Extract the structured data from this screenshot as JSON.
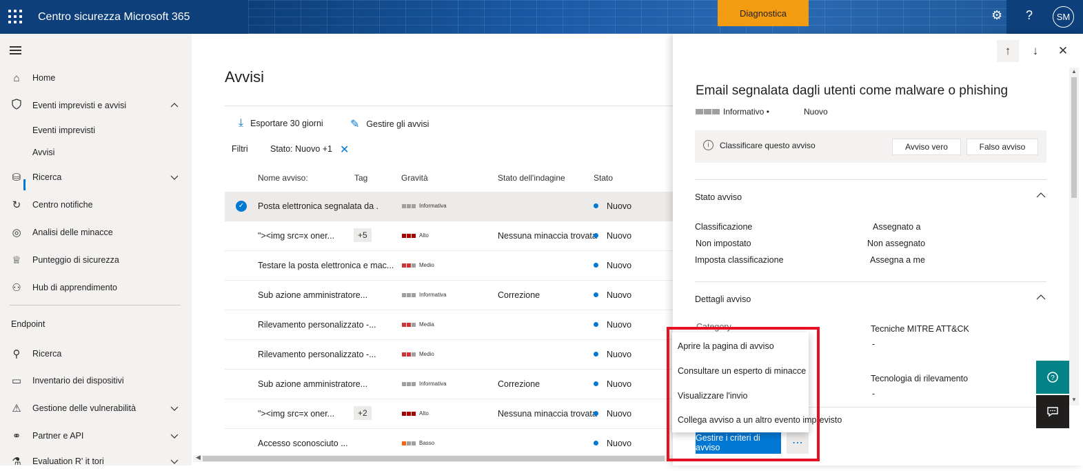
{
  "topbar": {
    "app_title": "Centro sicurezza Microsoft 365",
    "diagnostic_label": "Diagnostica",
    "avatar_initials": "SM",
    "settings_icon": "gear-icon",
    "help_icon": "question-icon"
  },
  "sidebar": {
    "items": [
      {
        "label": "Home",
        "icon": "home-icon"
      },
      {
        "label": "Eventi imprevisti e avvisi",
        "icon": "shield-icon"
      },
      {
        "label": "Eventi imprevisti"
      },
      {
        "label": "Avvisi"
      },
      {
        "label": "Ricerca",
        "icon": "hunting-icon"
      },
      {
        "label": "Centro notifiche",
        "icon": "action-center-icon"
      },
      {
        "label": "Analisi delle minacce",
        "icon": "threat-analytics-icon"
      },
      {
        "label": "Punteggio di sicurezza",
        "icon": "trophy-icon"
      },
      {
        "label": "Hub di apprendimento",
        "icon": "learning-icon"
      }
    ],
    "section_endpoint": "Endpoint",
    "endpoint_items": [
      {
        "label": "Ricerca",
        "icon": "search-icon"
      },
      {
        "label": "Inventario dei dispositivi",
        "icon": "laptop-icon"
      },
      {
        "label": "Gestione delle vulnerabilità",
        "icon": "vulnerability-icon"
      },
      {
        "label": "Partner e API",
        "icon": "partner-icon"
      },
      {
        "label": "Evaluation  R' it tori",
        "icon": "evaluation-icon"
      }
    ]
  },
  "main": {
    "title": "Avvisi",
    "export_label": "Esportare 30 giorni",
    "manage_label": "Gestire gli avvisi",
    "filters_label": "Filtri",
    "filter_chip": "Stato: Nuovo +1",
    "columns": [
      "Nome avviso:",
      "Tag",
      "Gravità",
      "Stato dell'indagine",
      "Stato"
    ],
    "rows": [
      {
        "name": "Posta elettronica segnalata da .",
        "tag": "",
        "severity": "Informativa",
        "sev_colors": [
          "#a19f9d",
          "#a19f9d",
          "#a19f9d"
        ],
        "investigation": "",
        "status": "Nuovo"
      },
      {
        "name": "\"><img src=x oner...",
        "tag": "+5",
        "severity": "Alto",
        "sev_colors": [
          "#a80000",
          "#a80000",
          "#a80000"
        ],
        "investigation": "Nessuna minaccia trovata",
        "status": "Nuovo"
      },
      {
        "name": "Testare la posta elettronica e mac...",
        "tag": "",
        "severity": "Medio",
        "sev_colors": [
          "#d13438",
          "#d13438",
          "#a19f9d"
        ],
        "investigation": "",
        "status": "Nuovo"
      },
      {
        "name": "Sub azione amministratore...",
        "tag": "",
        "severity": "Informativa",
        "sev_colors": [
          "#a19f9d",
          "#a19f9d",
          "#a19f9d"
        ],
        "investigation": "Correzione",
        "status": "Nuovo"
      },
      {
        "name": "Rilevamento personalizzato -...",
        "tag": "",
        "severity": "Media",
        "sev_colors": [
          "#d13438",
          "#d13438",
          "#a19f9d"
        ],
        "investigation": "",
        "status": "Nuovo"
      },
      {
        "name": "Rilevamento personalizzato -...",
        "tag": "",
        "severity": "Medio",
        "sev_colors": [
          "#d13438",
          "#d13438",
          "#a19f9d"
        ],
        "investigation": "",
        "status": "Nuovo"
      },
      {
        "name": "Sub azione amministratore...",
        "tag": "",
        "severity": "Informativa",
        "sev_colors": [
          "#a19f9d",
          "#a19f9d",
          "#a19f9d"
        ],
        "investigation": "Correzione",
        "status": "Nuovo"
      },
      {
        "name": "\"><img src=x oner...",
        "tag": "+2",
        "severity": "Alto",
        "sev_colors": [
          "#a80000",
          "#a80000",
          "#a80000"
        ],
        "investigation": "Nessuna minaccia trovata",
        "status": "Nuovo"
      },
      {
        "name": "Accesso sconosciuto ...",
        "tag": "",
        "severity": "Basso",
        "sev_colors": [
          "#f7630c",
          "#a19f9d",
          "#a19f9d"
        ],
        "investigation": "",
        "status": "Nuovo"
      }
    ]
  },
  "panel": {
    "title": "Email segnalata dagli utenti come malware o phishing",
    "severity": "Informativo •",
    "status": "Nuovo",
    "classify_text": "Classificare questo avviso",
    "true_alert": "Avviso vero",
    "false_alert": "Falso avviso",
    "state_section": "Stato avviso",
    "classification_label": "Classificazione",
    "classification_value": "Non impostato",
    "set_classification": "Imposta classificazione",
    "assigned_label": "Assegnato a",
    "assigned_value": "Non assegnato",
    "assign_to_me": "Assegna a me",
    "details_section": "Dettagli avviso",
    "category_label": "Category",
    "mitre_label": "Tecniche MITRE ATT&CK",
    "mitre_value": "-",
    "detection_label": "Tecnologia di rilevamento",
    "detection_value": "-",
    "primary_button": "Gestire i criteri di avviso",
    "more_button": "⋯"
  },
  "context_menu": {
    "items": [
      "Aprire la pagina di avviso",
      "Consultare un esperto di minacce",
      "Visualizzare l'invio",
      "Collega avviso a un altro evento imprevisto"
    ]
  },
  "colors": {
    "accent": "#0078d4",
    "highlight": "#e81123",
    "diagnostic": "#f39c11"
  }
}
